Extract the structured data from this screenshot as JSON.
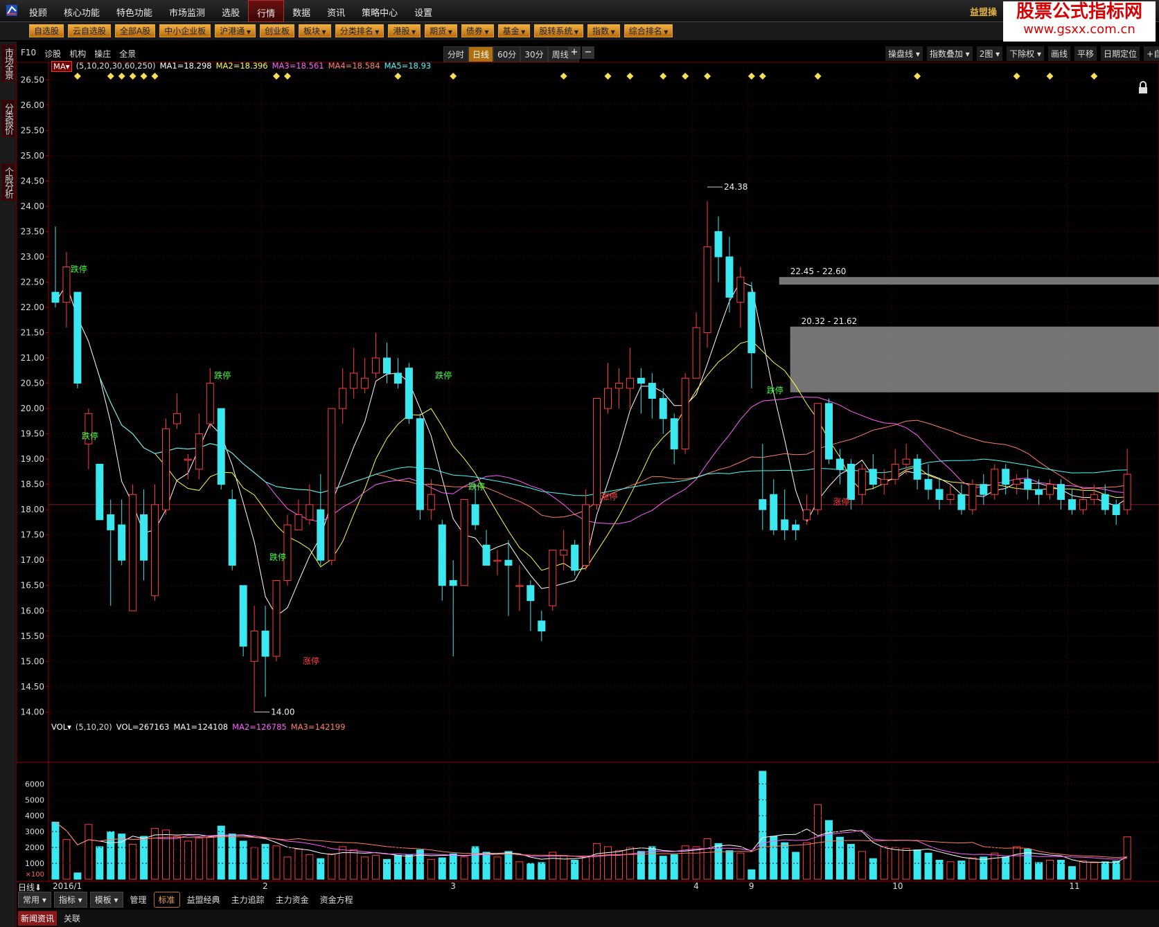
{
  "menu": {
    "items": [
      "投顾",
      "核心功能",
      "特色功能",
      "市场监测",
      "选股",
      "行情",
      "数据",
      "资讯",
      "策略中心",
      "设置"
    ],
    "active_index": 5,
    "brand": "益盟操"
  },
  "watermark": {
    "line1": "股票公式指标网",
    "line2": "www.gsxx.com.cn"
  },
  "quickbar": [
    {
      "label": "自选股",
      "dd": false
    },
    {
      "label": "云自选股",
      "dd": false
    },
    {
      "label": "全部A股",
      "dd": false
    },
    {
      "label": "中小企业板",
      "dd": false
    },
    {
      "label": "沪港通",
      "dd": true
    },
    {
      "label": "创业板",
      "dd": false
    },
    {
      "label": "板块",
      "dd": true
    },
    {
      "label": "分类排名",
      "dd": true
    },
    {
      "label": "港股",
      "dd": true
    },
    {
      "label": "期货",
      "dd": true
    },
    {
      "label": "债券",
      "dd": true
    },
    {
      "label": "基金",
      "dd": true
    },
    {
      "label": "股转系统",
      "dd": true
    },
    {
      "label": "指数",
      "dd": true
    },
    {
      "label": "综合排名",
      "dd": true
    }
  ],
  "leftbar": [
    "市场全景",
    "分类报价",
    "个股分析"
  ],
  "toolbar": {
    "left": [
      "F10",
      "诊股",
      "机构",
      "操庄",
      "全景"
    ],
    "periods": [
      "分时",
      "日线",
      "60分",
      "30分",
      "周线 ▾"
    ],
    "selected_period": 1,
    "zoom": [
      "+",
      "−"
    ],
    "right": [
      "操盘线 ▾",
      "指数叠加 ▾",
      "2图 ▾",
      "下除权 ▾",
      "画线",
      "平移",
      "日期定位",
      "+自选 ▾"
    ]
  },
  "ma_legend": {
    "name": "MA▾",
    "params": "(5,10,20,30,60,250)",
    "items": [
      {
        "text": "MA1=18.298",
        "color": "#ffffff"
      },
      {
        "text": "MA2=18.396",
        "color": "#ffff40"
      },
      {
        "text": "MA3=18.561",
        "color": "#ff60ff"
      },
      {
        "text": "MA4=18.584",
        "color": "#ff8060"
      },
      {
        "text": "MA5=18.93",
        "color": "#40ffff"
      }
    ]
  },
  "vol_legend": {
    "name": "VOL▾",
    "params": "(5,10,20)",
    "items": [
      {
        "text": "VOL=267163",
        "color": "#ffffff"
      },
      {
        "text": "MA1=124108",
        "color": "#ffffff"
      },
      {
        "text": "MA2=126785",
        "color": "#ff60ff"
      },
      {
        "text": "MA3=142199",
        "color": "#ff8060"
      }
    ]
  },
  "chart_data": {
    "type": "candlestick",
    "price_axis": [
      26.5,
      26.0,
      25.5,
      25.0,
      24.5,
      24.0,
      23.5,
      23.0,
      22.5,
      22.0,
      21.5,
      21.0,
      20.5,
      20.0,
      19.5,
      19.0,
      18.5,
      18.0,
      17.5,
      17.0,
      16.5,
      16.0,
      15.5,
      15.0,
      14.5,
      14.0
    ],
    "price_range": [
      13.95,
      26.6
    ],
    "vol_axis": [
      6000,
      5000,
      4000,
      3000,
      2000,
      1000
    ],
    "vol_unit": "×100",
    "vol_range": [
      0,
      6800
    ],
    "date_labels": [
      {
        "text": "2016/1",
        "i": 0
      },
      {
        "text": "2",
        "i": 19
      },
      {
        "text": "3",
        "i": 36
      },
      {
        "text": "4",
        "i": 58
      },
      {
        "text": "9",
        "i": 63
      },
      {
        "text": "10",
        "i": 76
      },
      {
        "text": "11",
        "i": 92
      }
    ],
    "candles": [
      [
        22.3,
        22.1,
        23.6,
        22.0,
        3600
      ],
      [
        22.1,
        22.8,
        23.1,
        21.6,
        2500
      ],
      [
        22.3,
        20.5,
        22.3,
        20.4,
        400
      ],
      [
        19.3,
        19.9,
        20.0,
        18.8,
        3450
      ],
      [
        18.9,
        17.8,
        18.9,
        17.8,
        2050
      ],
      [
        17.9,
        17.6,
        18.2,
        16.1,
        3000
      ],
      [
        17.7,
        17.0,
        18.2,
        16.9,
        2850
      ],
      [
        16.0,
        18.3,
        18.5,
        16.0,
        2200
      ],
      [
        17.9,
        17.0,
        18.4,
        16.6,
        2700
      ],
      [
        16.3,
        18.1,
        18.5,
        16.2,
        3200
      ],
      [
        18.0,
        19.6,
        19.8,
        17.9,
        3100
      ],
      [
        19.7,
        19.9,
        20.3,
        19.6,
        2700
      ],
      [
        19.0,
        19.0,
        19.1,
        18.6,
        2400
      ],
      [
        18.8,
        19.5,
        19.9,
        18.6,
        2600
      ],
      [
        19.7,
        20.5,
        20.8,
        19.6,
        2650
      ],
      [
        20.0,
        18.5,
        20.0,
        18.4,
        3350
      ],
      [
        18.2,
        16.9,
        18.4,
        16.8,
        2850
      ],
      [
        16.5,
        15.3,
        16.5,
        15.1,
        2400
      ],
      [
        15.0,
        15.6,
        16.1,
        14.0,
        2000
      ],
      [
        15.6,
        15.1,
        16.1,
        14.3,
        2200
      ],
      [
        15.1,
        16.6,
        16.6,
        15.0,
        2100
      ],
      [
        16.6,
        17.7,
        17.9,
        16.5,
        1400
      ],
      [
        17.6,
        17.9,
        18.2,
        17.6,
        1900
      ],
      [
        17.8,
        18.1,
        18.5,
        17.7,
        1550
      ],
      [
        18.0,
        17.0,
        18.7,
        16.9,
        1300
      ],
      [
        17.0,
        20.0,
        20.0,
        16.9,
        1600
      ],
      [
        20.0,
        20.4,
        20.8,
        19.7,
        2050
      ],
      [
        20.4,
        20.7,
        21.2,
        20.2,
        1850
      ],
      [
        20.4,
        20.6,
        21.0,
        20.3,
        1400
      ],
      [
        20.7,
        21.0,
        21.5,
        20.6,
        1500
      ],
      [
        21.0,
        20.7,
        21.3,
        20.5,
        1250
      ],
      [
        20.7,
        20.5,
        21.0,
        20.4,
        1500
      ],
      [
        20.8,
        19.8,
        20.9,
        19.7,
        1550
      ],
      [
        19.8,
        18.0,
        19.9,
        17.8,
        1850
      ],
      [
        18.0,
        18.3,
        18.6,
        17.8,
        1250
      ],
      [
        17.7,
        16.5,
        17.8,
        16.2,
        1350
      ],
      [
        16.6,
        16.5,
        17.0,
        15.1,
        1600
      ],
      [
        16.5,
        18.2,
        18.2,
        16.5,
        1400
      ],
      [
        18.1,
        17.7,
        18.5,
        17.6,
        2050
      ],
      [
        17.3,
        16.9,
        17.6,
        16.9,
        1700
      ],
      [
        17.0,
        17.0,
        17.2,
        16.7,
        1400
      ],
      [
        17.0,
        16.9,
        17.4,
        15.9,
        1750
      ],
      [
        16.5,
        16.5,
        16.9,
        16.0,
        1100
      ],
      [
        16.5,
        16.2,
        16.6,
        15.6,
        1000
      ],
      [
        15.8,
        15.6,
        16.0,
        15.4,
        1050
      ],
      [
        16.1,
        17.2,
        17.2,
        16.0,
        1700
      ],
      [
        17.1,
        17.2,
        17.6,
        16.8,
        1500
      ],
      [
        17.3,
        16.8,
        17.4,
        16.7,
        1200
      ],
      [
        16.9,
        18.1,
        18.4,
        16.8,
        1400
      ],
      [
        18.1,
        20.2,
        20.2,
        18.0,
        2250
      ],
      [
        20.0,
        20.4,
        20.9,
        19.9,
        2050
      ],
      [
        20.4,
        20.5,
        20.8,
        20.0,
        1800
      ],
      [
        20.4,
        20.6,
        21.2,
        20.0,
        2000
      ],
      [
        20.6,
        20.5,
        20.8,
        19.9,
        1750
      ],
      [
        20.5,
        20.2,
        20.7,
        19.8,
        2050
      ],
      [
        20.2,
        19.8,
        20.4,
        19.5,
        1450
      ],
      [
        19.8,
        19.2,
        19.9,
        18.9,
        1550
      ],
      [
        19.2,
        20.6,
        20.7,
        19.1,
        2100
      ],
      [
        20.6,
        21.6,
        21.9,
        20.6,
        2050
      ],
      [
        21.5,
        23.2,
        24.1,
        21.2,
        2550
      ],
      [
        23.5,
        23.0,
        23.8,
        22.5,
        2250
      ],
      [
        23.0,
        22.2,
        23.4,
        21.9,
        1800
      ],
      [
        22.1,
        22.6,
        22.8,
        21.6,
        1650
      ],
      [
        22.3,
        21.1,
        22.5,
        20.4,
        600
      ],
      [
        18.2,
        18.0,
        19.3,
        17.6,
        6800
      ],
      [
        18.3,
        17.6,
        18.6,
        17.5,
        2700
      ],
      [
        17.8,
        17.6,
        18.4,
        17.4,
        2300
      ],
      [
        17.7,
        17.6,
        17.8,
        17.4,
        1700
      ],
      [
        17.8,
        18.0,
        18.3,
        17.7,
        2300
      ],
      [
        18.0,
        20.1,
        20.1,
        17.9,
        4700
      ],
      [
        20.1,
        19.0,
        20.2,
        18.9,
        3700
      ],
      [
        19.0,
        18.8,
        19.2,
        18.5,
        2650
      ],
      [
        18.9,
        18.2,
        19.0,
        18.0,
        2200
      ],
      [
        18.3,
        18.8,
        18.9,
        18.1,
        1750
      ],
      [
        18.8,
        18.5,
        19.1,
        18.4,
        1300
      ],
      [
        18.5,
        18.6,
        18.8,
        18.3,
        2050
      ],
      [
        18.6,
        18.9,
        19.2,
        18.5,
        2000
      ],
      [
        18.9,
        19.0,
        19.3,
        18.7,
        1950
      ],
      [
        19.0,
        18.6,
        19.1,
        18.4,
        1850
      ],
      [
        18.6,
        18.4,
        18.9,
        18.2,
        1650
      ],
      [
        18.4,
        18.2,
        18.6,
        18.0,
        1200
      ],
      [
        18.2,
        18.3,
        18.5,
        18.1,
        1100
      ],
      [
        18.3,
        18.0,
        18.5,
        17.9,
        1150
      ],
      [
        18.0,
        18.5,
        18.6,
        17.9,
        1350
      ],
      [
        18.5,
        18.3,
        18.7,
        18.1,
        1400
      ],
      [
        18.3,
        18.8,
        18.9,
        18.2,
        1650
      ],
      [
        18.8,
        18.5,
        18.9,
        18.3,
        1400
      ],
      [
        18.5,
        18.6,
        18.7,
        18.3,
        2050
      ],
      [
        18.6,
        18.4,
        18.8,
        18.2,
        1900
      ],
      [
        18.4,
        18.3,
        18.6,
        18.1,
        1050
      ],
      [
        18.3,
        18.5,
        18.6,
        18.2,
        1200
      ],
      [
        18.5,
        18.2,
        18.6,
        18.0,
        1200
      ],
      [
        18.2,
        18.0,
        18.4,
        17.9,
        800
      ],
      [
        18.0,
        18.2,
        18.4,
        17.9,
        1150
      ],
      [
        18.2,
        18.3,
        18.5,
        18.1,
        1050
      ],
      [
        18.3,
        18.0,
        18.5,
        17.9,
        1100
      ],
      [
        18.1,
        17.9,
        18.2,
        17.7,
        1150
      ],
      [
        18.0,
        18.7,
        19.2,
        17.9,
        2670
      ]
    ],
    "ma_lines": [
      {
        "name": "MA1",
        "color": "#ffffff"
      },
      {
        "name": "MA2",
        "color": "#ffff40"
      },
      {
        "name": "MA3",
        "color": "#ff60ff"
      },
      {
        "name": "MA4",
        "color": "#ff8060"
      },
      {
        "name": "MA5",
        "color": "#40ffff"
      }
    ],
    "zones": [
      {
        "label": "22.45 - 22.60",
        "low": 22.45,
        "high": 22.6,
        "from_i": 66
      },
      {
        "label": "20.32 - 21.62",
        "low": 20.32,
        "high": 21.62,
        "from_i": 67
      }
    ],
    "extremes": [
      {
        "label": "24.38",
        "price": 24.38,
        "i": 59
      },
      {
        "label": "14.00",
        "price": 14.0,
        "i": 18
      }
    ],
    "limit_labels": [
      {
        "text": "跌停",
        "i": 2,
        "price": 22.7,
        "kind": "down"
      },
      {
        "text": "跌停",
        "i": 3,
        "price": 19.4,
        "kind": "down"
      },
      {
        "text": "跌停",
        "i": 15,
        "price": 20.6,
        "kind": "down"
      },
      {
        "text": "跌停",
        "i": 20,
        "price": 17.0,
        "kind": "down"
      },
      {
        "text": "涨停",
        "i": 23,
        "price": 14.95,
        "kind": "up"
      },
      {
        "text": "跌停",
        "i": 35,
        "price": 20.6,
        "kind": "down"
      },
      {
        "text": "跌停",
        "i": 38,
        "price": 18.4,
        "kind": "down"
      },
      {
        "text": "涨停",
        "i": 50,
        "price": 18.2,
        "kind": "up"
      },
      {
        "text": "跌停",
        "i": 65,
        "price": 20.3,
        "kind": "down"
      },
      {
        "text": "涨停",
        "i": 71,
        "price": 18.1,
        "kind": "up"
      }
    ],
    "diamond_indices": [
      2,
      5,
      6,
      7,
      8,
      9,
      20,
      21,
      31,
      36,
      46,
      50,
      52,
      55,
      57,
      59,
      63,
      64,
      69,
      78,
      87,
      90,
      94
    ],
    "ref_price": 18.1
  },
  "daybar": "日线⬇",
  "bottombar": {
    "items": [
      {
        "label": "常用 ▾",
        "style": "box"
      },
      {
        "label": "指标 ▾",
        "style": "box"
      },
      {
        "label": "模板 ▾",
        "style": "box"
      },
      {
        "label": "管理",
        "style": ""
      },
      {
        "label": "标准",
        "style": "hl"
      },
      {
        "label": "益盟经典",
        "style": ""
      },
      {
        "label": "主力追踪",
        "style": ""
      },
      {
        "label": "主力资金",
        "style": ""
      },
      {
        "label": "资金方程",
        "style": ""
      }
    ]
  },
  "newsbar": {
    "items": [
      "新闻资讯",
      "关联"
    ],
    "selected": 0
  }
}
